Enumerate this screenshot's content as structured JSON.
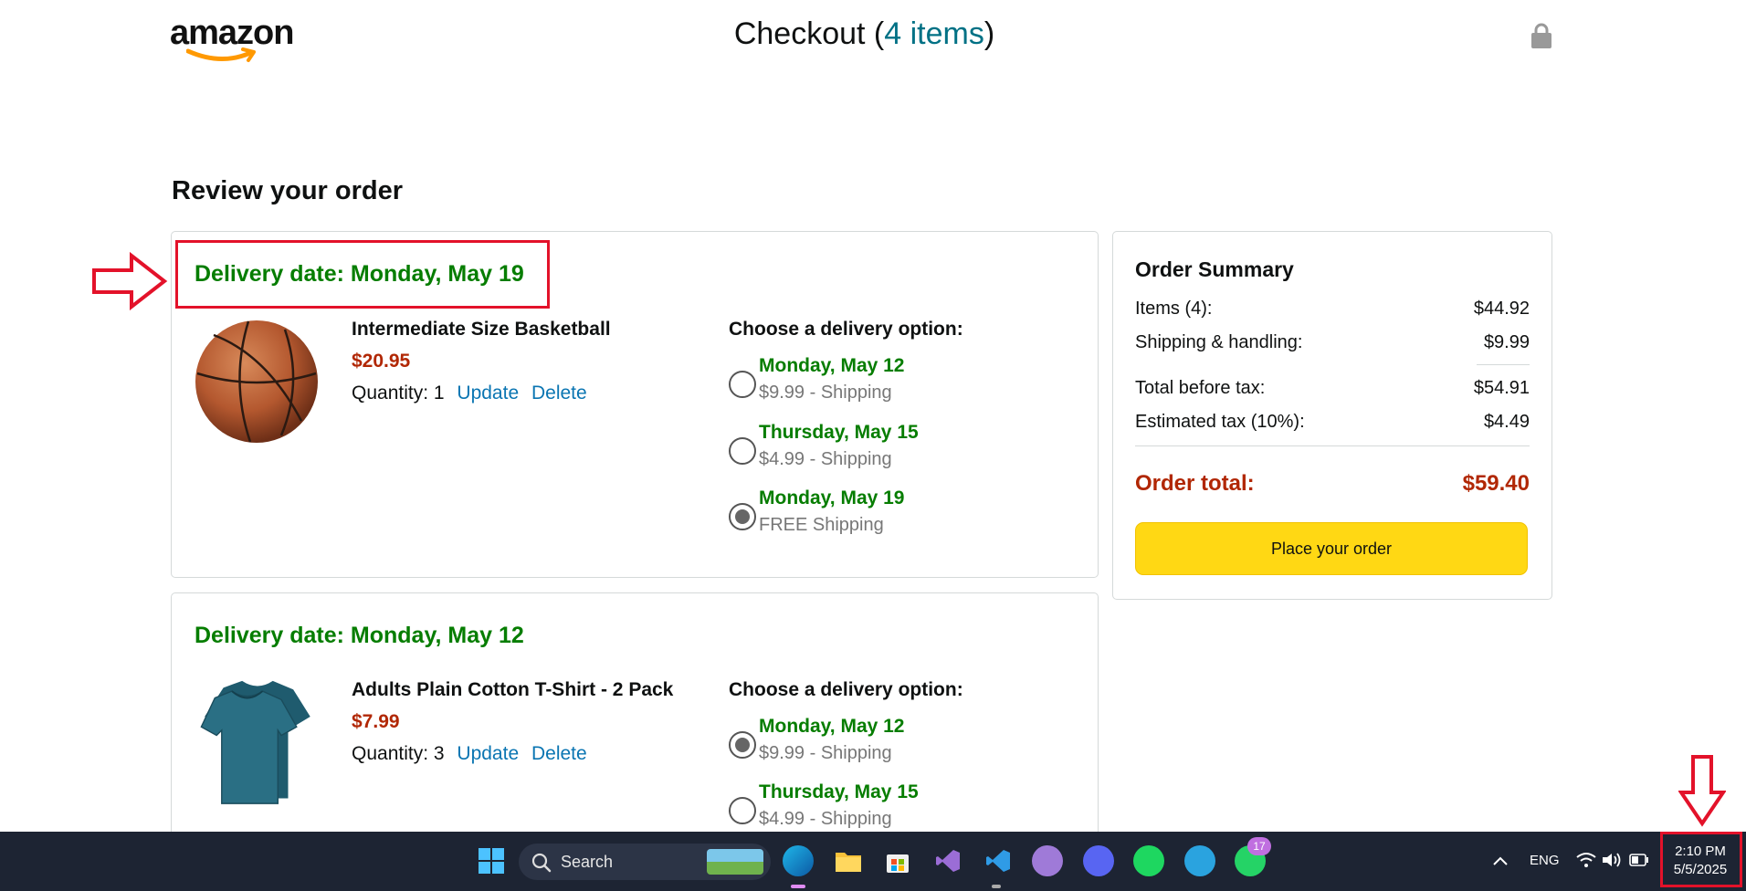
{
  "header": {
    "logo_text": "amazon",
    "title_prefix": "Checkout (",
    "items_link": "4 items",
    "title_suffix": ")"
  },
  "review_title": "Review your order",
  "orders": [
    {
      "delivery_date": "Delivery date: Monday, May 19",
      "product_name": "Intermediate Size Basketball",
      "price": "$20.95",
      "quantity": "Quantity: 1",
      "update_label": "Update",
      "delete_label": "Delete",
      "choose_label": "Choose a delivery option:",
      "options": [
        {
          "date": "Monday, May 12",
          "shipping": "$9.99 - Shipping",
          "selected": false
        },
        {
          "date": "Thursday, May 15",
          "shipping": "$4.99 - Shipping",
          "selected": false
        },
        {
          "date": "Monday, May 19",
          "shipping": "FREE Shipping",
          "selected": true
        }
      ]
    },
    {
      "delivery_date": "Delivery date: Monday, May 12",
      "product_name": "Adults Plain Cotton T-Shirt - 2 Pack",
      "price": "$7.99",
      "quantity": "Quantity: 3",
      "update_label": "Update",
      "delete_label": "Delete",
      "choose_label": "Choose a delivery option:",
      "options": [
        {
          "date": "Monday, May 12",
          "shipping": "$9.99 - Shipping",
          "selected": true
        },
        {
          "date": "Thursday, May 15",
          "shipping": "$4.99 - Shipping",
          "selected": false
        }
      ]
    }
  ],
  "summary": {
    "title": "Order Summary",
    "rows": [
      {
        "label": "Items (4):",
        "value": "$44.92"
      },
      {
        "label": "Shipping & handling:",
        "value": "$9.99"
      },
      {
        "label": "Total before tax:",
        "value": "$54.91"
      },
      {
        "label": "Estimated tax (10%):",
        "value": "$4.49"
      }
    ],
    "total_label": "Order total:",
    "total_value": "$59.40",
    "place_order_label": "Place your order"
  },
  "taskbar": {
    "search_label": "Search",
    "language": "ENG",
    "time": "2:10 PM",
    "date": "5/5/2025",
    "whatsapp_badge": "17"
  },
  "colors": {
    "green": "#067d00",
    "price_red": "#b12704",
    "link_blue": "#0a75b2",
    "button_yellow": "#ffd814",
    "annotation_red": "#e3122a",
    "taskbar_bg": "#1d2433"
  }
}
